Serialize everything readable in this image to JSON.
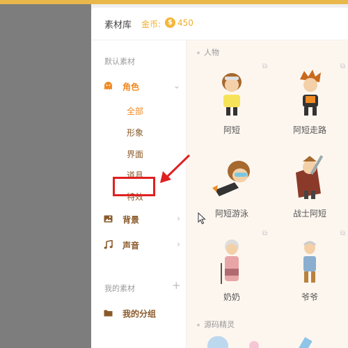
{
  "header": {
    "title": "素材库",
    "coins_label": "金币:",
    "coin_symbol": "$",
    "coins_value": "450"
  },
  "sidebar": {
    "default_section": "默认素材",
    "categories": [
      {
        "label": "角色",
        "icon": "ghost-character-icon",
        "expanded": true,
        "items": [
          "全部",
          "形象",
          "界面",
          "道具",
          "特效"
        ]
      },
      {
        "label": "背景",
        "icon": "image-icon"
      },
      {
        "label": "声音",
        "icon": "music-note-icon"
      }
    ],
    "my_section": "我的素材",
    "my_groups": "我的分组"
  },
  "content": {
    "groups": [
      {
        "label": "人物",
        "items": [
          "阿短",
          "阿短走路",
          "阿短游泳",
          "战士阿短",
          "奶奶",
          "爷爷"
        ]
      },
      {
        "label": "源码精灵"
      }
    ]
  },
  "colors": {
    "accent": "#f08a22",
    "annotation": "#e02020",
    "coin": "#f4b63a"
  }
}
